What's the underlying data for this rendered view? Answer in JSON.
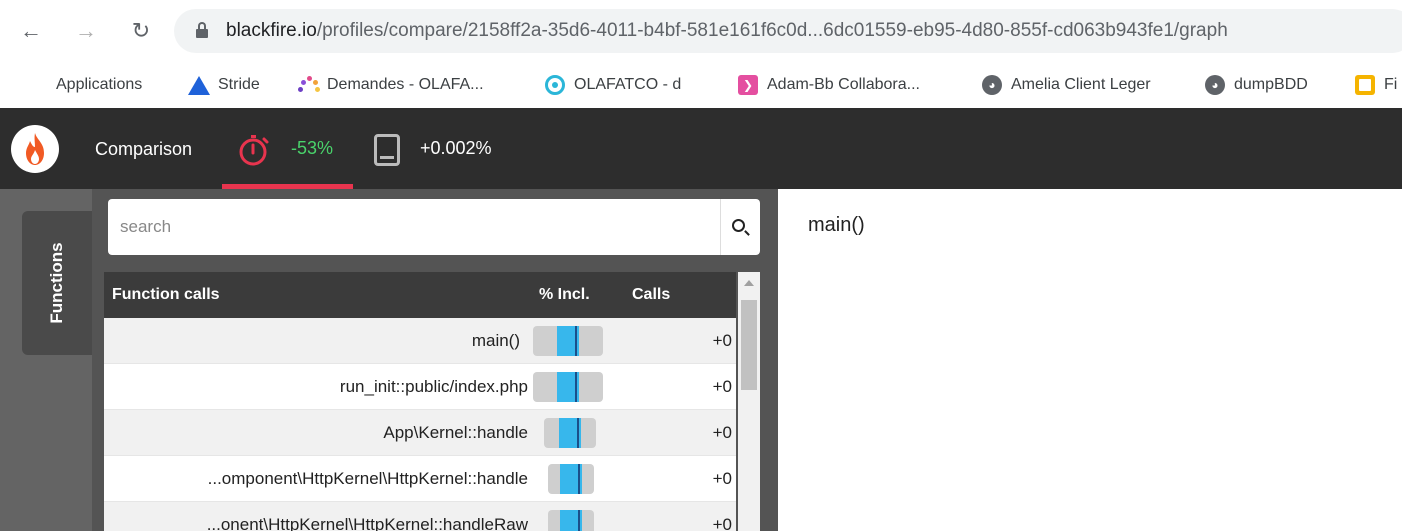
{
  "browser": {
    "url_host": "blackfire.io",
    "url_path": "/profiles/compare/2158ff2a-35d6-4011-b4bf-581e161f6c0d...6dc01559-eb95-4d80-855f-cd063b943fe1/graph"
  },
  "bookmarks": [
    {
      "label": "Applications",
      "icon": "apps-grid-icon"
    },
    {
      "label": "Stride",
      "icon": "stride-icon"
    },
    {
      "label": "Demandes - OLAFA...",
      "icon": "dots-arc-icon"
    },
    {
      "label": "OLAFATCO - d",
      "icon": "ring-icon"
    },
    {
      "label": "Adam-Bb Collabora...",
      "icon": "pink-arrow-icon"
    },
    {
      "label": "Amelia Client Leger",
      "icon": "globe-icon"
    },
    {
      "label": "dumpBDD",
      "icon": "globe-icon"
    },
    {
      "label": "Fi",
      "icon": "yellow-square-icon"
    }
  ],
  "header": {
    "title": "Comparison",
    "time_delta": "-53%",
    "memory_delta": "+0.002%",
    "accent": "#e8344e",
    "positive_color": "#49d36b"
  },
  "sidebar": {
    "tab_label": "Functions"
  },
  "search": {
    "placeholder": "search"
  },
  "table": {
    "headers": {
      "name": "Function calls",
      "incl": "% Incl.",
      "calls": "Calls"
    },
    "rows": [
      {
        "name": "main()",
        "incl_fraction": 1.0,
        "calls": "+0"
      },
      {
        "name": "run_init::public/index.php",
        "incl_fraction": 1.0,
        "calls": "+0"
      },
      {
        "name": "App\\Kernel::handle",
        "incl_fraction": 1.0,
        "calls": "+0"
      },
      {
        "name": "...omponent\\HttpKernel\\HttpKernel::handle",
        "incl_fraction": 1.0,
        "calls": "+0"
      },
      {
        "name": "...onent\\HttpKernel\\HttpKernel::handleRaw",
        "incl_fraction": 1.0,
        "calls": "+0"
      }
    ]
  },
  "detail": {
    "title": "main()"
  }
}
